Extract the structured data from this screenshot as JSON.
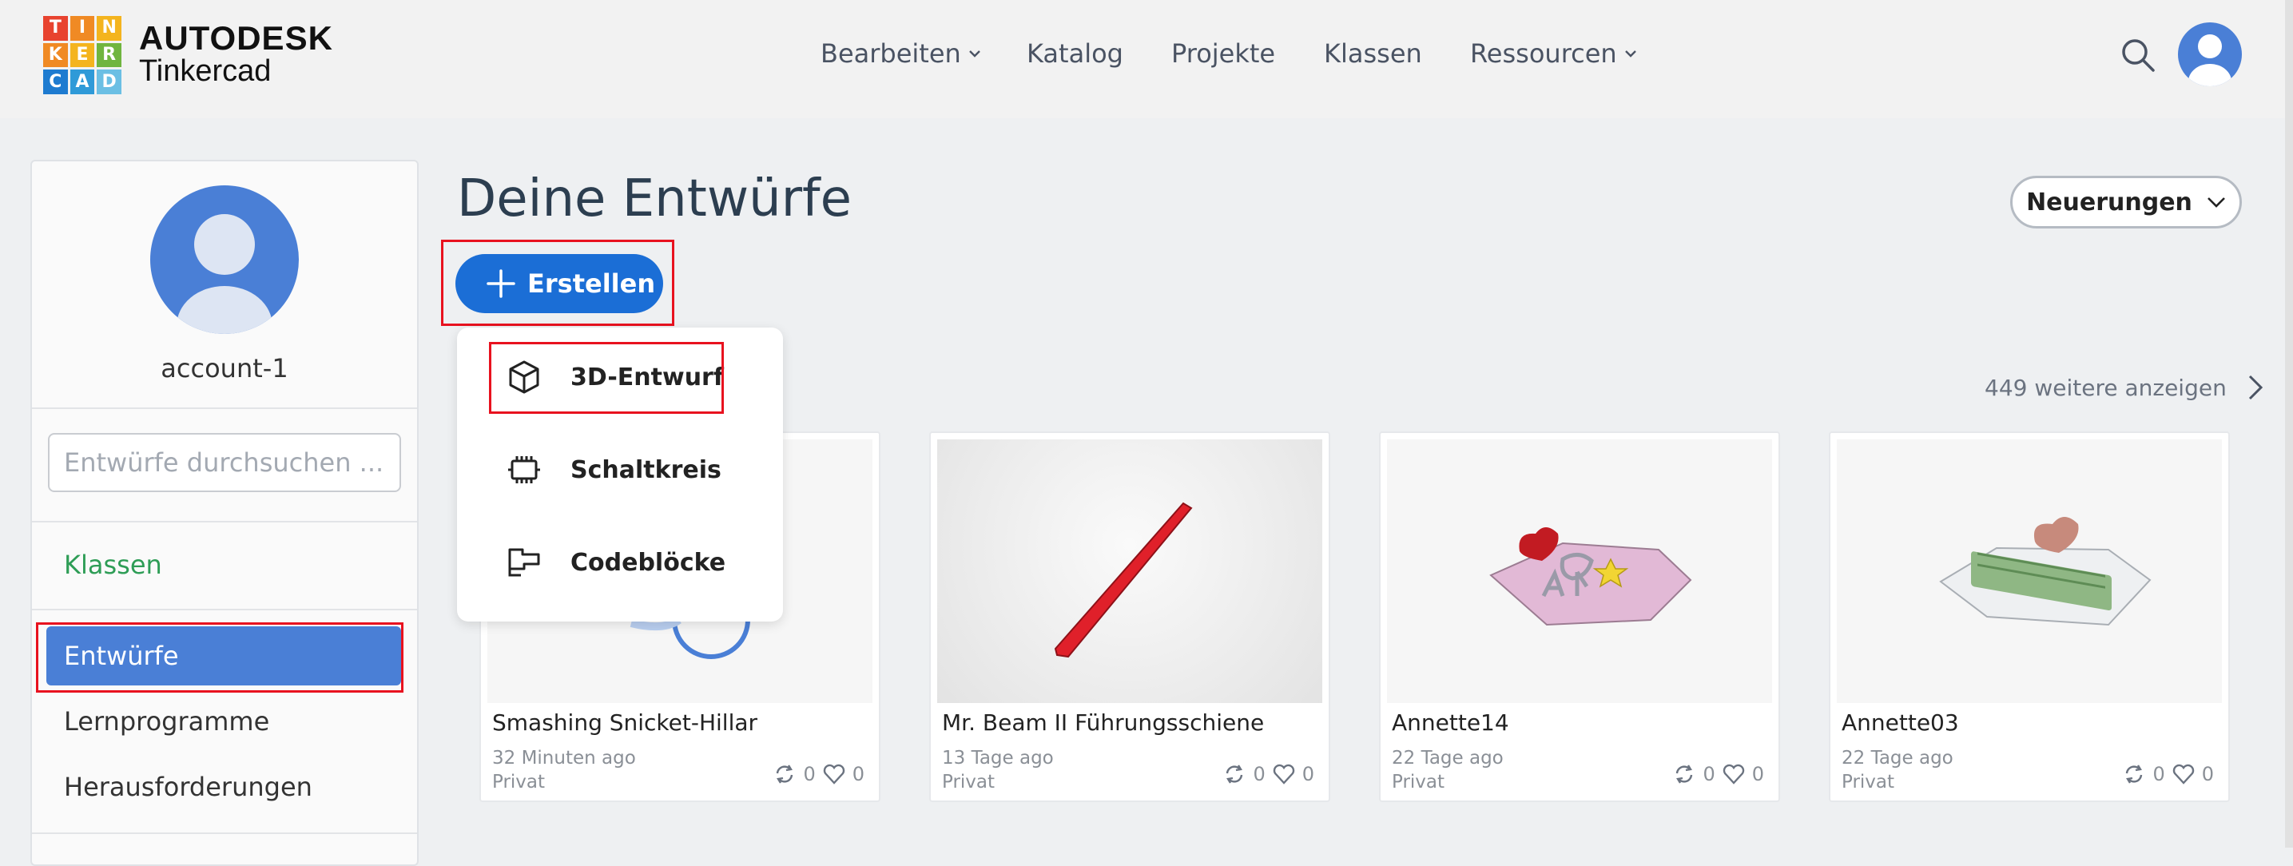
{
  "header": {
    "logo_letters": [
      "T",
      "I",
      "N",
      "K",
      "E",
      "R",
      "C",
      "A",
      "D"
    ],
    "brand_line1": "AUTODESK",
    "brand_line2": "Tinkercad",
    "nav": [
      {
        "label": "Bearbeiten",
        "has_dropdown": true
      },
      {
        "label": "Katalog",
        "has_dropdown": false
      },
      {
        "label": "Projekte",
        "has_dropdown": false
      },
      {
        "label": "Klassen",
        "has_dropdown": false
      },
      {
        "label": "Ressourcen",
        "has_dropdown": true
      }
    ],
    "icons": [
      "search-icon",
      "user-avatar"
    ]
  },
  "sidebar": {
    "account_name": "account-1",
    "search_placeholder": "Entwürfe durchsuchen ...",
    "klassen_label": "Klassen",
    "items": [
      {
        "label": "Entwürfe",
        "active": true
      },
      {
        "label": "Lernprogramme",
        "active": false
      },
      {
        "label": "Herausforderungen",
        "active": false
      }
    ]
  },
  "main": {
    "title": "Deine Entwürfe",
    "create_label": "Erstellen",
    "news_label": "Neuerungen",
    "more_label": "449 weitere anzeigen",
    "dropdown": [
      {
        "label": "3D-Entwurf",
        "icon": "cube-icon"
      },
      {
        "label": "Schaltkreis",
        "icon": "circuit-chip-icon"
      },
      {
        "label": "Codeblöcke",
        "icon": "code-blocks-icon"
      }
    ],
    "designs": [
      {
        "name": "Smashing Snicket-Hillar",
        "age": "32 Minuten ago",
        "visibility": "Privat",
        "remixes": "0",
        "likes": "0"
      },
      {
        "name": "Mr. Beam II Führungsschiene",
        "age": "13 Tage ago",
        "visibility": "Privat",
        "remixes": "0",
        "likes": "0"
      },
      {
        "name": "Annette14",
        "age": "22 Tage ago",
        "visibility": "Privat",
        "remixes": "0",
        "likes": "0"
      },
      {
        "name": "Annette03",
        "age": "22 Tage ago",
        "visibility": "Privat",
        "remixes": "0",
        "likes": "0"
      }
    ]
  },
  "colors": {
    "accent_blue": "#1b6ed6",
    "active_item": "#4a7fd6",
    "klassen_green": "#2e9d56",
    "highlight_red": "#e8121f"
  }
}
